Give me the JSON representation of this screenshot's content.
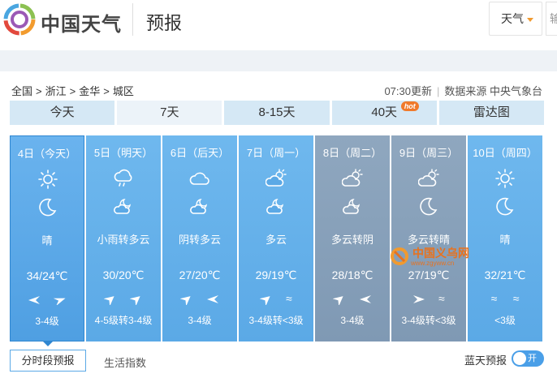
{
  "header": {
    "brand": "中国天气",
    "section": "预报",
    "weather_dropdown": "天气",
    "search_stub": "输"
  },
  "breadcrumb": [
    "全国",
    "浙江",
    "金华",
    "城区"
  ],
  "breadcrumb_sep": ">",
  "update": {
    "time": "07:30更新",
    "source": "数据来源 中央气象台"
  },
  "tabs": [
    {
      "label": "今天"
    },
    {
      "label": "7天",
      "active": true
    },
    {
      "label": "8-15天"
    },
    {
      "label": "40天",
      "badge": "hot"
    },
    {
      "label": "雷达图"
    }
  ],
  "days": [
    {
      "date": "4日（今天）",
      "icon_day": "sun-icon",
      "icon_night": "moon-icon",
      "desc": "晴",
      "temp": "34/24℃",
      "wind_icons": [
        "arrow-wind-icon",
        "arrow-wind-icon"
      ],
      "level": "3-4级"
    },
    {
      "date": "5日（明天）",
      "icon_day": "rain-cloud-icon",
      "icon_night": "cloud-moon-icon",
      "desc": "小雨转多云",
      "temp": "30/20℃",
      "wind_icons": [
        "arrow-wind-icon",
        "arrow-wind-icon"
      ],
      "level": "4-5级转3-4级"
    },
    {
      "date": "6日（后天）",
      "icon_day": "cloud-icon",
      "icon_night": "cloud-moon-icon",
      "desc": "阴转多云",
      "temp": "27/20℃",
      "wind_icons": [
        "arrow-wind-icon",
        "arrow-wind-icon"
      ],
      "level": "3-4级"
    },
    {
      "date": "7日（周一）",
      "icon_day": "sun-cloud-icon",
      "icon_night": "cloud-moon-icon",
      "desc": "多云",
      "temp": "29/19℃",
      "wind_icons": [
        "arrow-wind-icon",
        "breeze-icon"
      ],
      "level": "3-4级转<3级"
    },
    {
      "date": "8日（周二）",
      "icon_day": "sun-cloud-icon",
      "icon_night": "cloud-moon-icon",
      "desc": "多云转阴",
      "temp": "28/18℃",
      "wind_icons": [
        "arrow-wind-icon",
        "arrow-wind-icon"
      ],
      "level": "3-4级"
    },
    {
      "date": "9日（周三）",
      "icon_day": "sun-cloud-icon",
      "icon_night": "moon-icon",
      "desc": "多云转晴",
      "temp": "27/19℃",
      "wind_icons": [
        "arrow-wind-icon",
        "breeze-icon"
      ],
      "level": "3-4级转<3级"
    },
    {
      "date": "10日（周四）",
      "icon_day": "sun-icon",
      "icon_night": "moon-icon",
      "desc": "晴",
      "temp": "32/21℃",
      "wind_icons": [
        "breeze-icon",
        "breeze-icon"
      ],
      "level": "<3级"
    }
  ],
  "watermark": {
    "text": "中国义乌网",
    "url": "www.zgyww.cn"
  },
  "bottom": {
    "tab_hourly": "分时段预报",
    "tab_life": "生活指数",
    "sky_label": "蓝天预报",
    "toggle_label": "开"
  },
  "colors": {
    "card": "#5ba9e6",
    "card_grey": "#8fa7bf",
    "tab": "#d5e8f5",
    "hot": "#f07a2b",
    "toggle": "#4a9fe8"
  }
}
